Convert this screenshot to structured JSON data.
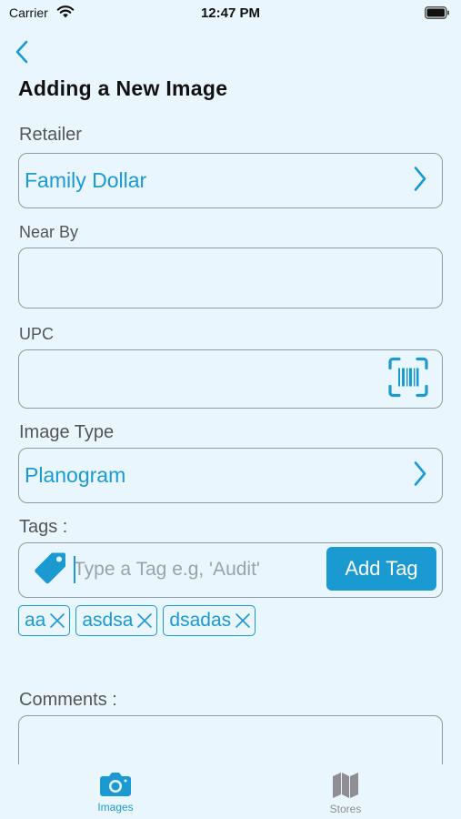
{
  "status_bar": {
    "carrier": "Carrier",
    "time": "12:47 PM"
  },
  "page": {
    "title": "Adding a New Image"
  },
  "retailer": {
    "label": "Retailer",
    "value": "Family Dollar"
  },
  "near_by": {
    "label": "Near By",
    "value": ""
  },
  "upc": {
    "label": "UPC",
    "value": ""
  },
  "image_type": {
    "label": "Image Type",
    "value": "Planogram"
  },
  "tags": {
    "label": "Tags :",
    "placeholder": "Type a Tag e.g, 'Audit'",
    "add_label": "Add Tag",
    "items": [
      "aa",
      "asdsa",
      "dsadas"
    ]
  },
  "comments": {
    "label": "Comments :"
  },
  "tab_bar": {
    "images_label": "Images",
    "stores_label": "Stores"
  },
  "colors": {
    "accent": "#1b9ad2",
    "background": "#e9f6fd",
    "border": "#8f9aa1",
    "inactive": "#8e8e93"
  },
  "icons": [
    "wifi-icon",
    "battery-icon",
    "back-chevron-icon",
    "chevron-right-icon",
    "barcode-scan-icon",
    "tag-icon",
    "close-icon",
    "camera-icon",
    "map-icon"
  ]
}
